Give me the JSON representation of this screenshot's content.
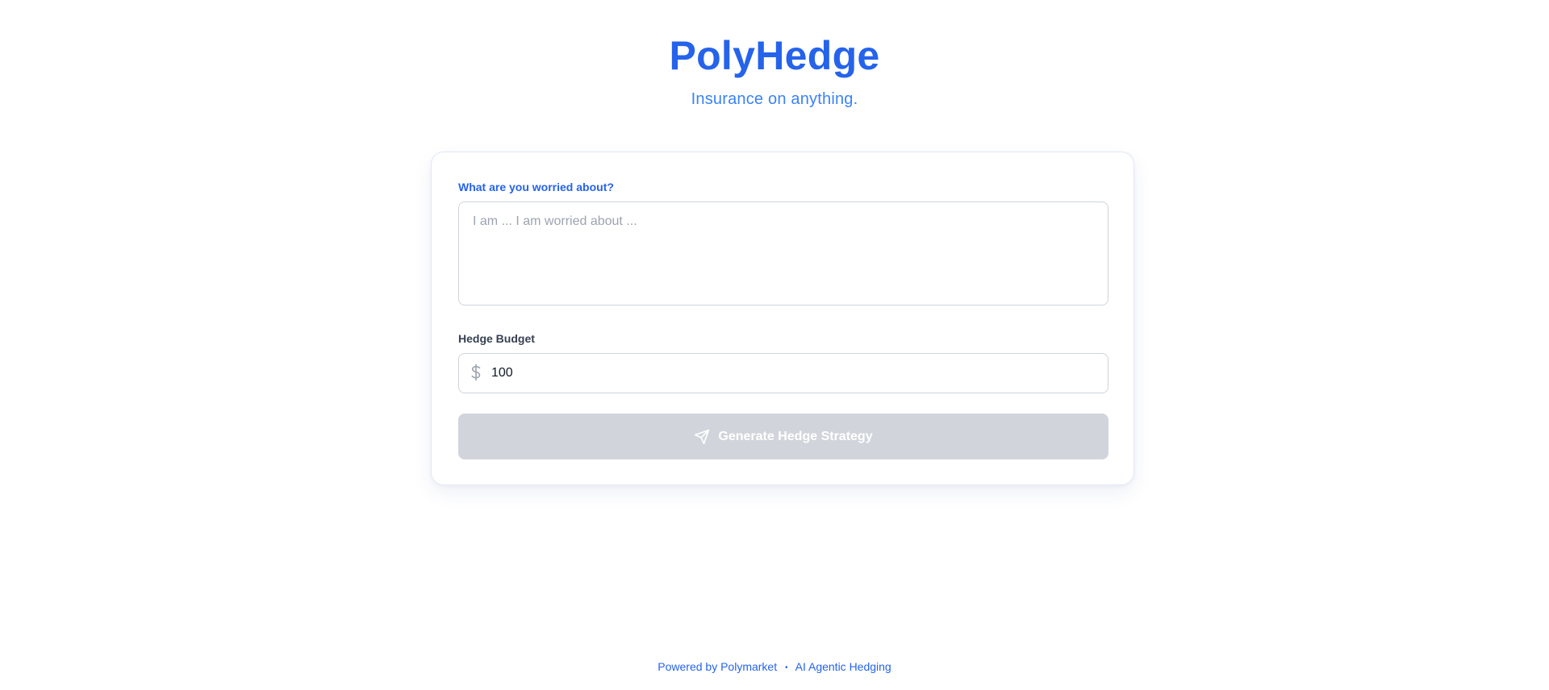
{
  "header": {
    "title": "PolyHedge",
    "subtitle": "Insurance on anything."
  },
  "form": {
    "worry_label": "What are you worried about?",
    "worry_placeholder": "I am ... I am worried about ...",
    "worry_value": "",
    "budget_label": "Hedge Budget",
    "budget_icon": "dollar-icon",
    "budget_value": "100",
    "submit_label": "Generate Hedge Strategy",
    "submit_icon": "send-icon",
    "submit_disabled": true
  },
  "footer": {
    "powered_by": "Powered by Polymarket",
    "separator": "•",
    "tagline": "AI Agentic Hedging"
  },
  "colors": {
    "brand": "#2563eb",
    "subtitle": "#3b82f6",
    "disabled_button": "#d1d5db",
    "input_border": "#cfd4dc"
  }
}
